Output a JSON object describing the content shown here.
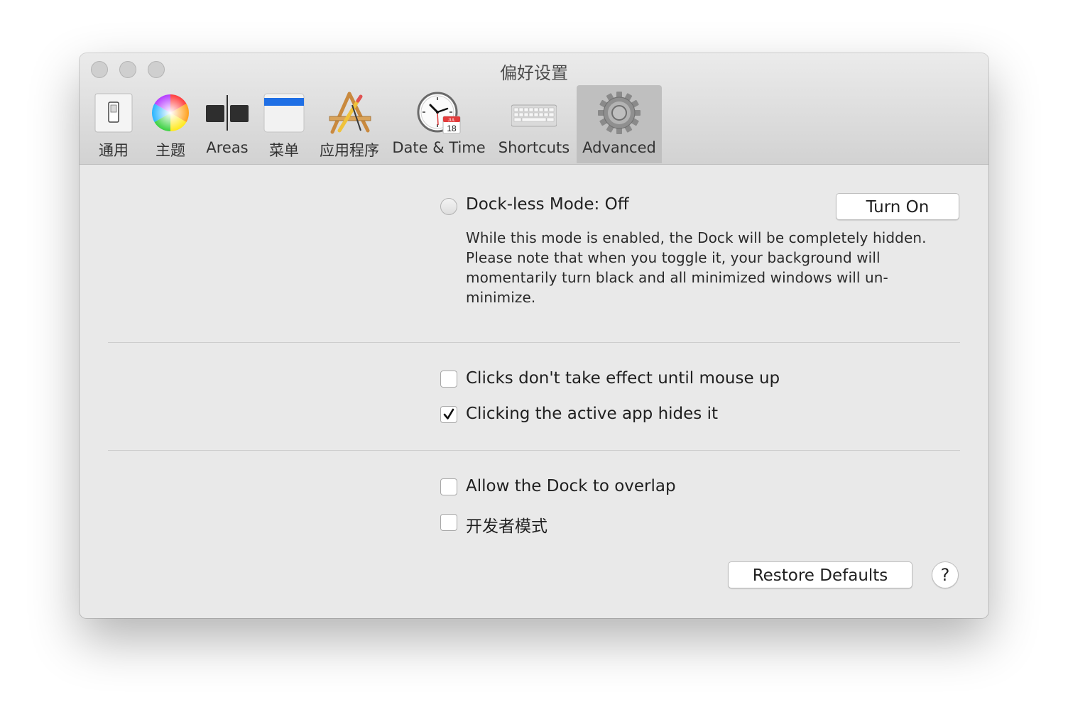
{
  "window": {
    "title": "偏好设置"
  },
  "toolbar": {
    "tabs": [
      {
        "label": "通用",
        "icon": "switch-icon"
      },
      {
        "label": "主题",
        "icon": "color-wheel-icon"
      },
      {
        "label": "Areas",
        "icon": "areas-icon"
      },
      {
        "label": "菜单",
        "icon": "menu-bar-icon"
      },
      {
        "label": "应用程序",
        "icon": "applications-icon"
      },
      {
        "label": "Date & Time",
        "icon": "clock-calendar-icon",
        "calendar_month": "JUL",
        "calendar_day": "18"
      },
      {
        "label": "Shortcuts",
        "icon": "keyboard-icon"
      },
      {
        "label": "Advanced",
        "icon": "gear-icon",
        "selected": true
      }
    ]
  },
  "dockless": {
    "label": "Dock-less Mode: Off",
    "button": "Turn On",
    "description": "While this mode is enabled, the Dock will be completely hidden. Please note that when you toggle it, your background will momentarily turn black and all minimized windows will un-minimize."
  },
  "options": {
    "clicks_mouse_up": {
      "label": "Clicks don't take effect until mouse up",
      "checked": false
    },
    "click_active_hides": {
      "label": "Clicking the active app hides it",
      "checked": true
    },
    "allow_overlap": {
      "label": "Allow the Dock to overlap",
      "checked": false
    },
    "developer_mode": {
      "label": "开发者模式",
      "checked": false
    }
  },
  "footer": {
    "restore": "Restore Defaults",
    "help": "?"
  },
  "colors": {
    "selected_tab": "#bfbfbf",
    "window_bg": "#e9e9e9",
    "menu_blue": "#1f6fe5"
  }
}
